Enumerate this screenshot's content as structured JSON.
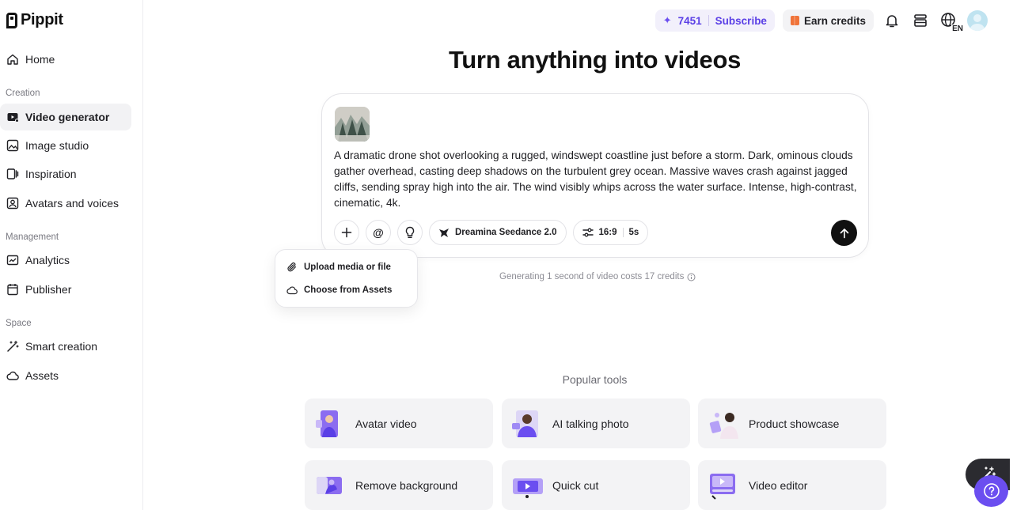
{
  "brand": {
    "name": "Pippit"
  },
  "sidebar": {
    "home": "Home",
    "sections": {
      "creation": "Creation",
      "management": "Management",
      "space": "Space"
    },
    "items": {
      "video_generator": "Video generator",
      "image_studio": "Image studio",
      "inspiration": "Inspiration",
      "avatars_voices": "Avatars and voices",
      "analytics": "Analytics",
      "publisher": "Publisher",
      "smart_creation": "Smart creation",
      "assets": "Assets"
    }
  },
  "topbar": {
    "credits": "7451",
    "subscribe": "Subscribe",
    "earn_credits": "Earn credits",
    "language": "EN"
  },
  "main": {
    "title": "Turn anything into videos",
    "prompt": "A dramatic drone shot overlooking a rugged, windswept coastline just before a storm. Dark, ominous clouds gather overhead, casting deep shadows on the turbulent grey ocean. Massive waves crash against jagged cliffs, sending spray high into the air. The wind visibly whips across the water surface. Intense, high-contrast, cinematic, 4k.",
    "model": "Dreamina Seedance 2.0",
    "aspect_ratio": "16:9",
    "duration": "5s",
    "mention_symbol": "@",
    "cost_note": "Generating 1 second of video costs 17 credits"
  },
  "upload_menu": {
    "upload": "Upload media or file",
    "assets": "Choose from Assets"
  },
  "popular": {
    "title": "Popular tools",
    "tools": [
      "Avatar video",
      "AI talking photo",
      "Product showcase",
      "Remove background",
      "Quick cut",
      "Video editor"
    ]
  },
  "colors": {
    "accent": "#6b4ef0",
    "accent_text": "#5a3fe6",
    "dark": "#111111"
  }
}
